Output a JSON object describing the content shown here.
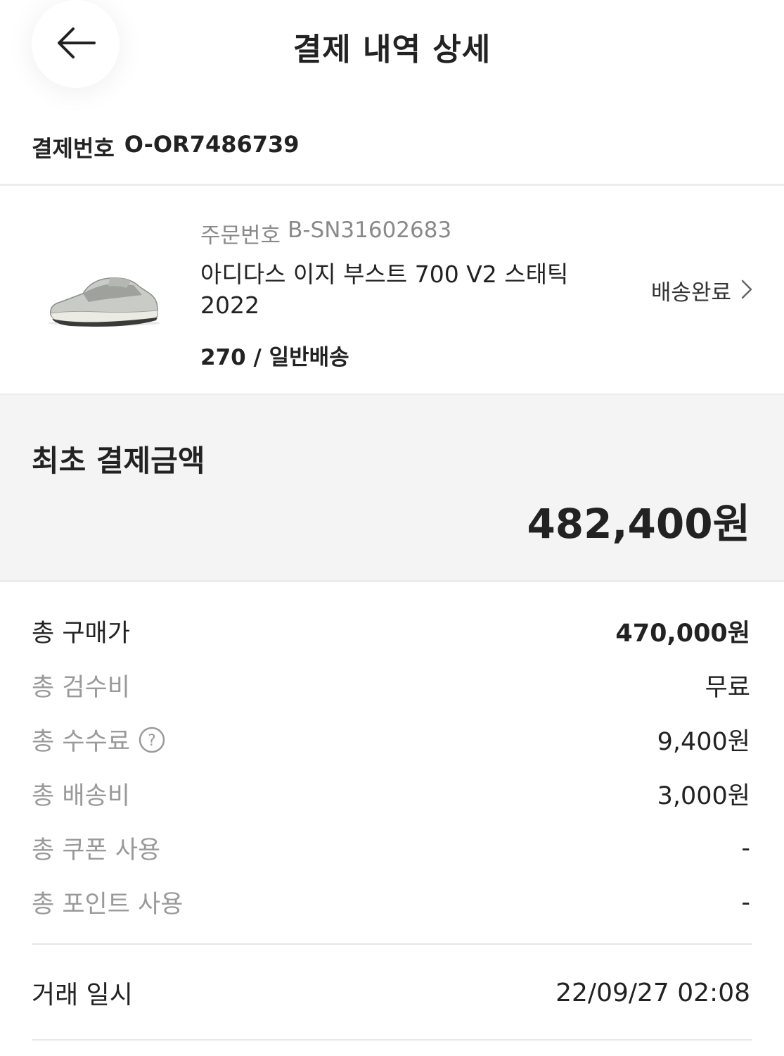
{
  "header": {
    "title": "결제 내역 상세",
    "back_icon": "arrow-left-icon"
  },
  "payment": {
    "label": "결제번호",
    "number": "O-OR7486739"
  },
  "product": {
    "order_label": "주문번호",
    "order_number": "B-SN31602683",
    "name": "아디다스 이지 부스트 700 V2 스태틱 2022",
    "option": "270 / 일반배송",
    "status": "배송완료",
    "status_icon": "chevron-right-icon",
    "image_icon": "sneaker-thumbnail"
  },
  "summary": {
    "title": "최초 결제금액",
    "amount": "482,400원"
  },
  "breakdown": [
    {
      "label": "총 구매가",
      "value": "470,000원"
    },
    {
      "label": "총 검수비",
      "value": "무료"
    },
    {
      "label": "총 수수료",
      "value": "9,400원",
      "help_icon": "question-circle-icon"
    },
    {
      "label": "총 배송비",
      "value": "3,000원"
    },
    {
      "label": "총 쿠폰 사용",
      "value": "-"
    },
    {
      "label": "총 포인트 사용",
      "value": "-"
    }
  ],
  "trade": {
    "label": "거래 일시",
    "value": "22/09/27 02:08"
  },
  "colors": {
    "text": "#222222",
    "muted": "#9a9a9a",
    "summary_bg": "#f4f4f4",
    "divider": "#ececec"
  }
}
